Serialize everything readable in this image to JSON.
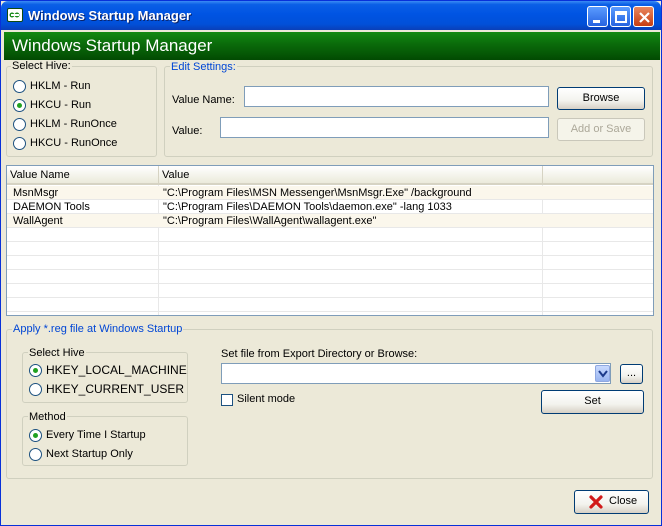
{
  "window": {
    "title": "Windows Startup Manager"
  },
  "banner": {
    "text": "Windows Startup Manager"
  },
  "select_hive": {
    "legend": "Select Hive:",
    "options": [
      {
        "label": "HKLM - Run",
        "selected": false
      },
      {
        "label": "HKCU - Run",
        "selected": true
      },
      {
        "label": "HKLM - RunOnce",
        "selected": false
      },
      {
        "label": "HKCU - RunOnce",
        "selected": false
      }
    ]
  },
  "edit_settings": {
    "legend": "Edit Settings:",
    "value_name_label": "Value Name:",
    "value_name": "",
    "value_label": "Value:",
    "value": "",
    "browse_label": "Browse",
    "add_label": "Add or Save"
  },
  "list": {
    "columns": [
      "Value Name",
      "Value"
    ],
    "rows": [
      {
        "name": "MsnMsgr",
        "value": "\"C:\\Program Files\\MSN Messenger\\MsnMsgr.Exe\" /background"
      },
      {
        "name": "DAEMON Tools",
        "value": "\"C:\\Program Files\\DAEMON Tools\\daemon.exe\" -lang 1033"
      },
      {
        "name": "WallAgent",
        "value": "\"C:\\Program Files\\WallAgent\\wallagent.exe\""
      }
    ]
  },
  "apply": {
    "legend": "Apply *.reg file at Windows Startup",
    "hive_legend": "Select Hive",
    "hive_options": [
      {
        "label": "HKEY_LOCAL_MACHINE",
        "selected": true
      },
      {
        "label": "HKEY_CURRENT_USER",
        "selected": false
      }
    ],
    "method_legend": "Method",
    "method_options": [
      {
        "label": "Every Time I Startup",
        "selected": true
      },
      {
        "label": "Next Startup Only",
        "selected": false
      }
    ],
    "file_label": "Set file from Export Directory or Browse:",
    "file_value": "",
    "browse_dots": "...",
    "silent_label": "Silent mode",
    "silent_checked": false,
    "set_label": "Set"
  },
  "close_label": "Close",
  "colors": {
    "banner_green": "#0b6d0b",
    "title_blue": "#0054e3",
    "legend_blue": "#0046d5"
  }
}
